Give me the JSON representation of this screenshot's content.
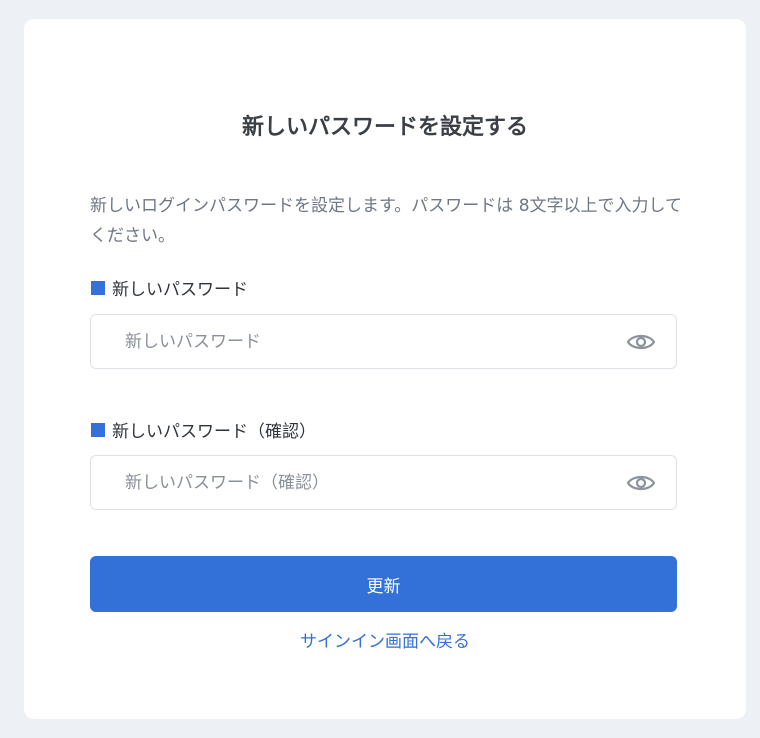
{
  "page": {
    "title": "新しいパスワードを設定する",
    "description": "新しいログインパスワードを設定します。パスワードは 8文字以上で入力してください。"
  },
  "fields": [
    {
      "label": "新しいパスワード",
      "placeholder": "新しいパスワード",
      "value": "",
      "toggle_icon": "eye-icon"
    },
    {
      "label": "新しいパスワード（確認）",
      "placeholder": "新しいパスワード（確認）",
      "value": "",
      "toggle_icon": "eye-icon"
    }
  ],
  "actions": {
    "submit_label": "更新",
    "back_link_label": "サインイン画面へ戻る"
  },
  "colors": {
    "accent": "#3370d8",
    "background": "#edf0f5",
    "card": "#ffffff",
    "title_text": "#3b3f46",
    "muted_text": "#6f7782",
    "icon": "#8d939c"
  }
}
